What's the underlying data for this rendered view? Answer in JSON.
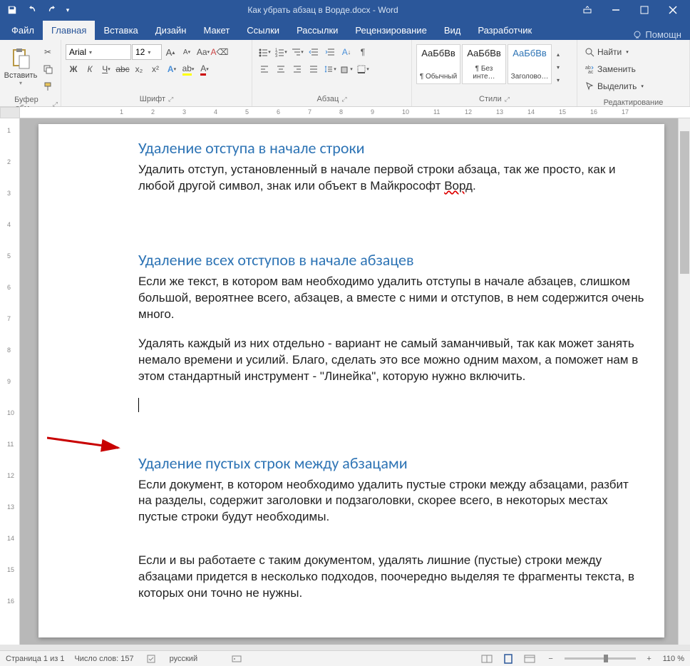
{
  "titlebar": {
    "doc_title": "Как убрать абзац в Ворде.docx - Word"
  },
  "tabs": {
    "file": "Файл",
    "home": "Главная",
    "insert": "Вставка",
    "design": "Дизайн",
    "layout": "Макет",
    "references": "Ссылки",
    "mailings": "Рассылки",
    "review": "Рецензирование",
    "view": "Вид",
    "developer": "Разработчик",
    "tell_me": "Помощн"
  },
  "ribbon": {
    "clipboard": {
      "paste": "Вставить",
      "label": "Буфер обм…"
    },
    "font": {
      "name": "Arial",
      "size": "12",
      "label": "Шрифт",
      "bold": "Ж",
      "italic": "К",
      "underline": "Ч",
      "strike": "abc",
      "sub": "x₂",
      "sup": "x²"
    },
    "paragraph": {
      "label": "Абзац"
    },
    "styles": {
      "label": "Стили",
      "items": [
        {
          "preview": "АаБбВв",
          "name": "¶ Обычный"
        },
        {
          "preview": "АаБбВв",
          "name": "¶ Без инте…"
        },
        {
          "preview": "АаБбВв",
          "name": "Заголово…"
        }
      ]
    },
    "editing": {
      "label": "Редактирование",
      "find": "Найти",
      "replace": "Заменить",
      "select": "Выделить"
    }
  },
  "document": {
    "h1": "Удаление отступа в начале строки",
    "p1_a": "Удалить отступ, установленный в начале первой строки абзаца, так же просто, как и любой другой символ, знак или объект в Майкрософт ",
    "p1_word": "Ворд",
    "p1_b": ".",
    "h2": "Удаление всех отступов в начале абзацев",
    "p2": "Если же текст, в котором вам необходимо удалить отступы в начале абзацев, слишком большой, вероятнее всего, абзацев, а вместе с ними и отступов, в нем содержится очень много.",
    "p3": "Удалять каждый из них отдельно - вариант не самый заманчивый, так как может занять немало времени и усилий. Благо, сделать это все можно одним махом, а поможет нам в этом стандартный инструмент - \"Линейка\", которую нужно включить.",
    "h3": "Удаление пустых строк между абзацами",
    "p4": "Если документ, в котором необходимо удалить пустые строки между абзацами, разбит на разделы, содержит заголовки и подзаголовки, скорее всего, в некоторых местах пустые строки будут необходимы.",
    "p5": "Если и вы работаете с таким документом, удалять лишние (пустые) строки между абзацами придется в несколько подходов, поочередно выделяя те фрагменты текста, в которых они точно не нужны."
  },
  "status": {
    "page": "Страница 1 из 1",
    "words": "Число слов: 157",
    "lang": "русский",
    "zoom": "110 %"
  },
  "ruler_h": [
    "1",
    "2",
    "3",
    "4",
    "5",
    "6",
    "7",
    "8",
    "9",
    "10",
    "11",
    "12",
    "13",
    "14",
    "15",
    "16",
    "17"
  ],
  "ruler_v": [
    "1",
    "2",
    "3",
    "4",
    "5",
    "6",
    "7",
    "8",
    "9",
    "10",
    "11",
    "12",
    "13",
    "14",
    "15",
    "16"
  ]
}
